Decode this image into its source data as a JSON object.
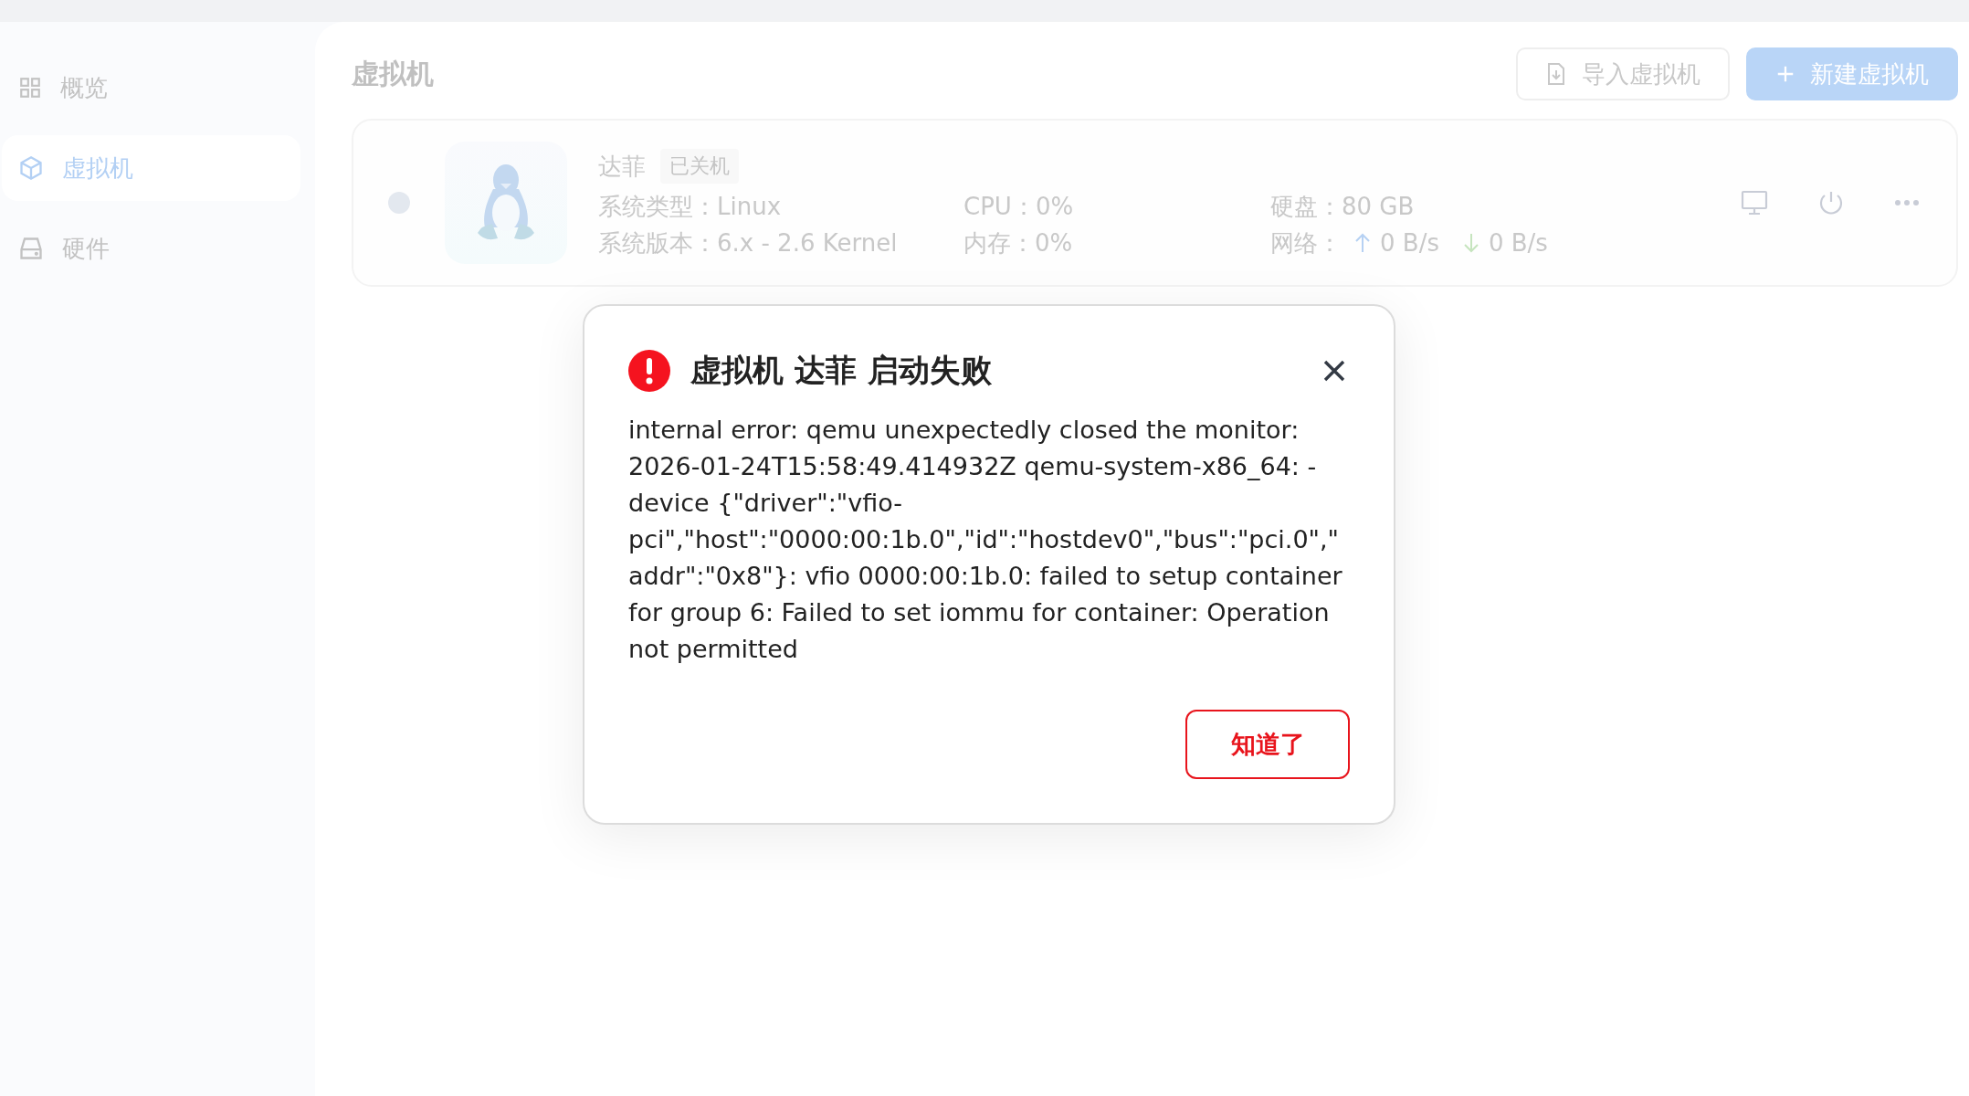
{
  "sidebar": {
    "items": [
      {
        "label": "概览",
        "kind": "grid",
        "selected": false
      },
      {
        "label": "虚拟机",
        "kind": "cube",
        "selected": true
      },
      {
        "label": "硬件",
        "kind": "drive",
        "selected": false
      }
    ]
  },
  "header": {
    "title": "虚拟机",
    "buttons": [
      {
        "label": "导入虚拟机",
        "kind": "secondary"
      },
      {
        "label": "新建虚拟机",
        "kind": "primary"
      }
    ]
  },
  "vm": {
    "name": "达菲",
    "status": "已关机",
    "running": false,
    "fields": [
      {
        "label": "系统类型：",
        "value": "Linux"
      },
      {
        "label": "CPU：",
        "value": "0%"
      },
      {
        "label": "硬盘：",
        "value": "80 GB"
      },
      {
        "label": "系统版本：",
        "value": "6.x - 2.6 Kernel"
      },
      {
        "label": "内存：",
        "value": "0%"
      }
    ],
    "network": {
      "label": "网络：",
      "up": "0 B/s",
      "down": "0 B/s"
    }
  },
  "dialog": {
    "title": "虚拟机 达菲 启动失败",
    "message": "internal error: qemu unexpectedly closed the monitor: 2026-01-24T15:58:49.414932Z qemu-system-x86_64: -device {\"driver\":\"vfio-pci\",\"host\":\"0000:00:1b.0\",\"id\":\"hostdev0\",\"bus\":\"pci.0\",\"addr\":\"0x8\"}: vfio 0000:00:1b.0: failed to setup container for group 6: Failed to set iommu for container: Operation not permitted",
    "button": "知道了"
  }
}
